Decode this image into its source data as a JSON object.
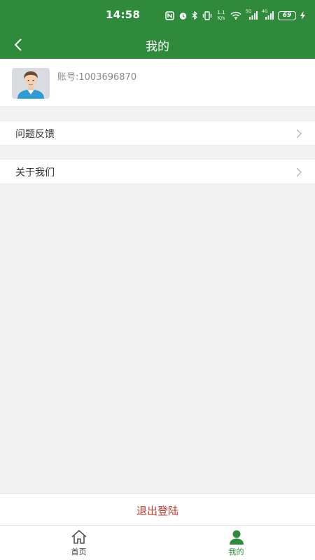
{
  "status_bar": {
    "time": "14:58",
    "battery": "69",
    "net_speed": "1.1 K/s",
    "signal_5g": "5G",
    "signal_4g": "4G"
  },
  "nav": {
    "title": "我的",
    "back_icon": "chevron-left-icon"
  },
  "profile": {
    "account_text": "账号:1003696870",
    "avatar_icon": "user-avatar-icon"
  },
  "menu": [
    {
      "label": "问题反馈",
      "icon": "chevron-right-icon"
    },
    {
      "label": "关于我们",
      "icon": "chevron-right-icon"
    }
  ],
  "logout": {
    "label": "退出登陆"
  },
  "tabs": [
    {
      "label": "首页",
      "icon": "home-icon",
      "active": false
    },
    {
      "label": "我的",
      "icon": "person-icon",
      "active": true
    }
  ],
  "colors": {
    "primary": "#2f8a3c",
    "logout": "#c0392b",
    "background": "#f3f3f3"
  }
}
